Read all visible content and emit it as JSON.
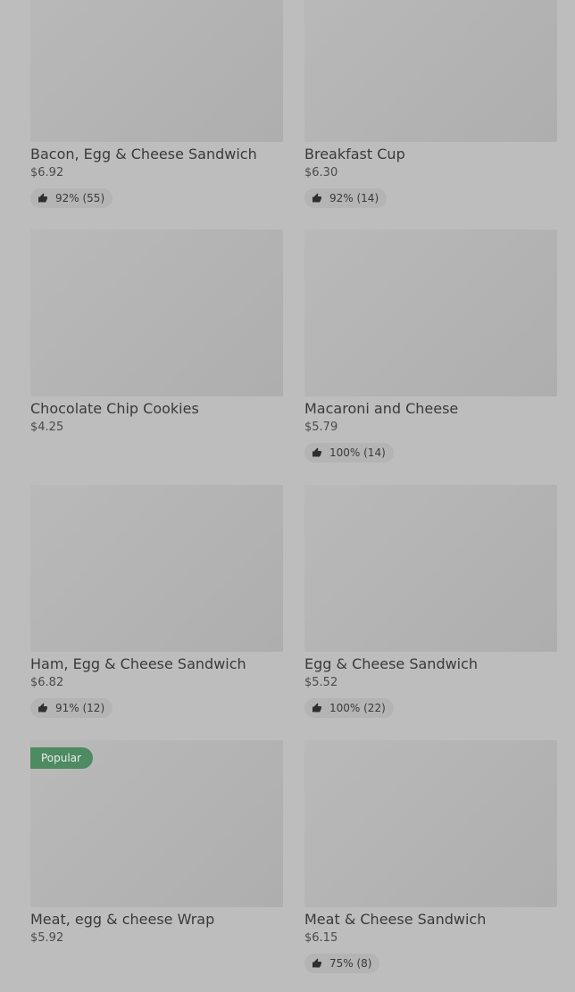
{
  "items": [
    {
      "name": "Bacon, Egg & Cheese Sandwich",
      "price": "$6.92",
      "rating": "92% (55)",
      "badge": null
    },
    {
      "name": "Breakfast Cup",
      "price": "$6.30",
      "rating": "92% (14)",
      "badge": null
    },
    {
      "name": "Chocolate Chip Cookies",
      "price": "$4.25",
      "rating": null,
      "badge": null
    },
    {
      "name": "Macaroni and Cheese",
      "price": "$5.79",
      "rating": "100% (14)",
      "badge": null
    },
    {
      "name": "Ham, Egg & Cheese Sandwich",
      "price": "$6.82",
      "rating": "91% (12)",
      "badge": null
    },
    {
      "name": "Egg & Cheese Sandwich",
      "price": "$5.52",
      "rating": "100% (22)",
      "badge": null
    },
    {
      "name": "Meat, egg & cheese Wrap",
      "price": "$5.92",
      "rating": null,
      "badge": "Popular"
    },
    {
      "name": "Meat & Cheese Sandwich",
      "price": "$6.15",
      "rating": "75% (8)",
      "badge": null
    }
  ],
  "icons": {
    "rating": "thumbs-up-icon"
  },
  "colors": {
    "background": "#bdbdbd",
    "image_placeholder": "#b3b3b3",
    "popular_badge": "#4e8a62",
    "rating_pill": "#b4b4b4",
    "text": "#3a3a3a"
  }
}
